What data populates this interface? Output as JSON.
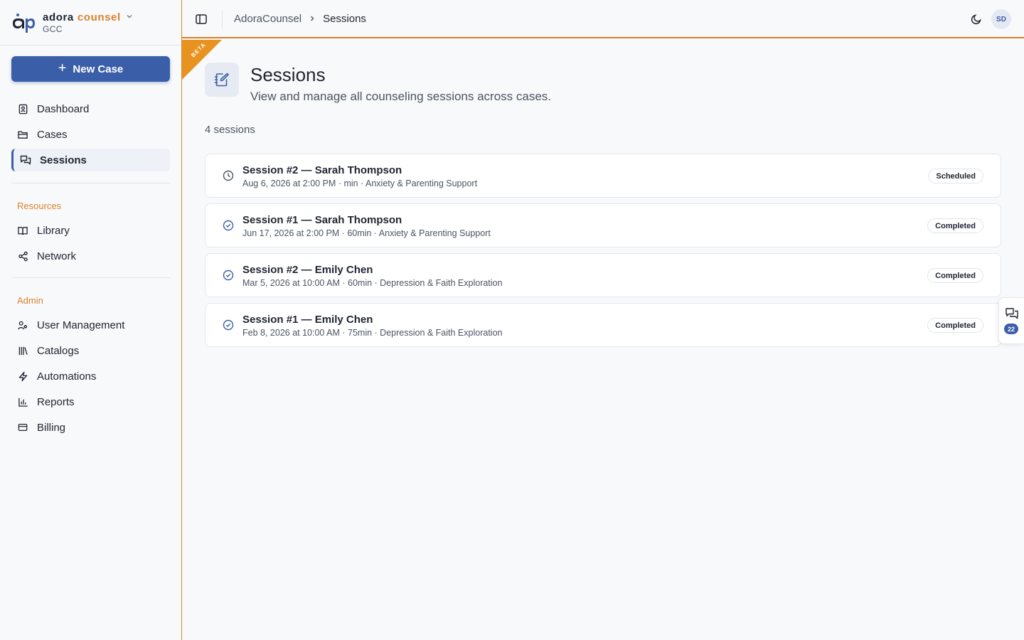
{
  "brand": {
    "logo_text": "ap",
    "name_part1": "adora",
    "name_part2": "counsel",
    "org": "GCC"
  },
  "sidebar": {
    "new_case_label": "New Case",
    "main_items": [
      {
        "label": "Dashboard",
        "icon": "dashboard-icon"
      },
      {
        "label": "Cases",
        "icon": "folder-icon"
      },
      {
        "label": "Sessions",
        "icon": "chat-icon",
        "active": true
      }
    ],
    "resources_label": "Resources",
    "resources_items": [
      {
        "label": "Library",
        "icon": "book-icon"
      },
      {
        "label": "Network",
        "icon": "share-icon"
      }
    ],
    "admin_label": "Admin",
    "admin_items": [
      {
        "label": "User Management",
        "icon": "users-icon"
      },
      {
        "label": "Catalogs",
        "icon": "library-icon"
      },
      {
        "label": "Automations",
        "icon": "bolt-icon"
      },
      {
        "label": "Reports",
        "icon": "bar-chart-icon"
      },
      {
        "label": "Billing",
        "icon": "credit-card-icon"
      }
    ]
  },
  "header": {
    "breadcrumb_root": "AdoraCounsel",
    "breadcrumb_current": "Sessions",
    "avatar_initials": "SD"
  },
  "beta_label": "BETA",
  "main": {
    "title": "Sessions",
    "subtitle": "View and manage all counseling sessions across cases.",
    "count_label": "4 sessions",
    "sessions": [
      {
        "title": "Session #2 — Sarah Thompson",
        "meta": "Aug 6, 2026 at 2:00 PM · min · Anxiety & Parenting Support",
        "status": "Scheduled",
        "icon": "clock-icon"
      },
      {
        "title": "Session #1 — Sarah Thompson",
        "meta": "Jun 17, 2026 at 2:00 PM · 60min · Anxiety & Parenting Support",
        "status": "Completed",
        "icon": "check-circle-icon"
      },
      {
        "title": "Session #2 — Emily Chen",
        "meta": "Mar 5, 2026 at 10:00 AM · 60min · Depression & Faith Exploration",
        "status": "Completed",
        "icon": "check-circle-icon"
      },
      {
        "title": "Session #1 — Emily Chen",
        "meta": "Feb 8, 2026 at 10:00 AM · 75min · Depression & Faith Exploration",
        "status": "Completed",
        "icon": "check-circle-icon"
      }
    ]
  },
  "chat_tab": {
    "count": "22"
  },
  "colors": {
    "primary": "#3b5ea8",
    "accent": "#d9822b",
    "beta": "#e8921f"
  }
}
